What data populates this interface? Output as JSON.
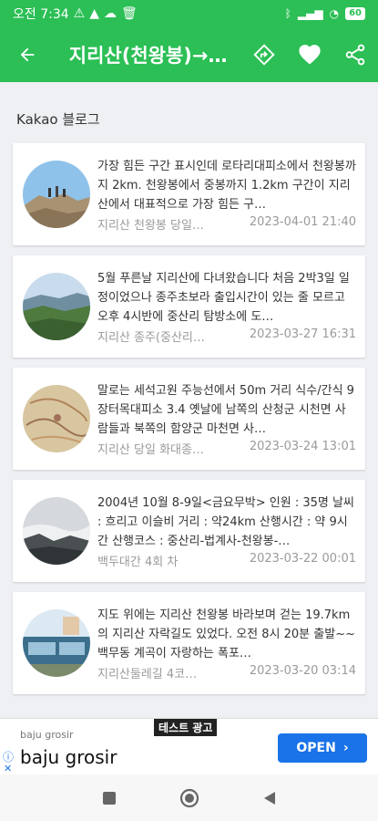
{
  "status": {
    "time": "오전 7:34",
    "battery": "60"
  },
  "appbar": {
    "title": "지리산(천왕봉)→…"
  },
  "section_title": "Kakao 블로그",
  "posts": [
    {
      "text": "가장 힘든 구간 표시인데 로타리대피소에서 천왕봉까지 2km. 천왕봉에서 중봉까지 1.2km 구간이 지리산에서 대표적으로 가장 힘든 구…",
      "source": "지리산 천왕봉 당일…",
      "date": "2023-04-01 21:40"
    },
    {
      "text": "5월 푸른날 지리산에 다녀왔습니다 처음 2박3일 일정이었으나 종주초보라 출입시간이 있는 줄 모르고 오후 4시반에 중산리 탐방소에 도…",
      "source": "지리산 종주(중산리…",
      "date": "2023-03-27 16:31"
    },
    {
      "text": "말로는 세석고원 주능선에서 50m 거리 식수/간식 9 장터목대피소 3.4 옛날에 남쪽의 산청군 시천면 사람들과 북쪽의 함양군 마천면 사…",
      "source": "지리산 당일 화대종…",
      "date": "2023-03-24 13:01"
    },
    {
      "text": "2004년 10월 8-9일<금요무박> 인원 : 35명 날씨 : 흐리고 이슬비 거리 : 약24km 산행시간 : 약 9시간 산행코스 : 중산리-법계사-천왕봉-…",
      "source": "백두대간 4회 차",
      "date": "2023-03-22 00:01"
    },
    {
      "text": "지도 위에는 지리산 천왕봉 바라보며 걷는 19.7km의 지리산 자락길도 있었다. 오전 8시 20분 출발~~ 백무동 계곡이 자랑하는 폭포…",
      "source": "지리산둘레길 4코…",
      "date": "2023-03-20 03:14"
    }
  ],
  "ad": {
    "label": "테스트 광고",
    "small_name": "baju grosir",
    "big_name": "baju grosir",
    "open_label": "OPEN"
  },
  "colors": {
    "primary": "#2bbf55",
    "ad_button": "#1a73e8"
  }
}
